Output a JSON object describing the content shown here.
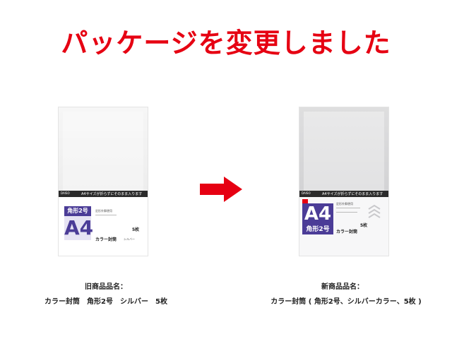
{
  "headline": "パッケージを変更しました",
  "arrow_icon": "right-arrow-icon",
  "colors": {
    "accent": "#e60012",
    "brand_purple": "#4b3c97"
  },
  "old_product": {
    "band_caption": "A4サイズが折らずにそのまま入ります",
    "size_label": "角形2号",
    "size_big": "A4",
    "usage": "定形外郵便用",
    "count": "5枚",
    "type": "カラー封筒",
    "color_tag": "シルバー",
    "caption_heading": "旧商品品名：",
    "caption_name": "カラー封筒　角形2号　シルバー　5枚"
  },
  "new_product": {
    "band_caption": "A4サイズが折らずにそのまま入ります",
    "size_label": "角形2号",
    "size_big": "A4",
    "usage": "定形外郵便用",
    "count": "5枚",
    "type": "カラー封筒",
    "caption_heading": "新商品品名：",
    "caption_name": "カラー封筒 ( 角形2号、シルバーカラー、5枚 )"
  }
}
